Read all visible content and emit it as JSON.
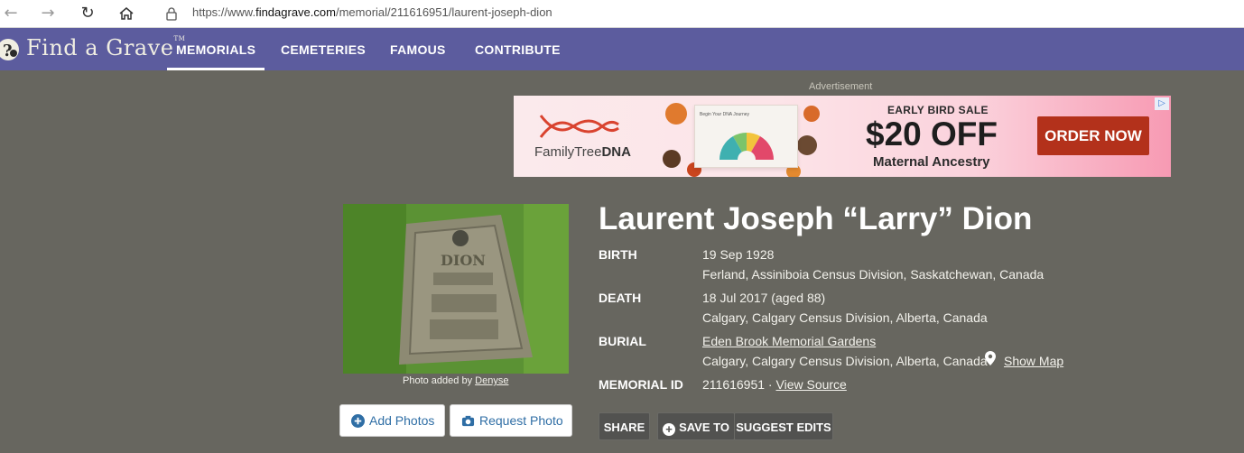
{
  "browser": {
    "url_prefix": "https://www.",
    "url_domain": "findagrave.com",
    "url_path": "/memorial/211616951/laurent-joseph-dion",
    "back_icon": "back-arrow-icon",
    "forward_icon": "forward-arrow-icon",
    "reload_icon": "reload-icon",
    "home_icon": "home-icon"
  },
  "header": {
    "logo": "Find a Grave",
    "logo_tm": "TM",
    "nav": [
      {
        "label": "MEMORIALS",
        "active": true
      },
      {
        "label": "CEMETERIES",
        "active": false
      },
      {
        "label": "FAMOUS",
        "active": false
      },
      {
        "label": "CONTRIBUTE",
        "active": false
      }
    ],
    "bg_color": "#5c5c9e"
  },
  "ad": {
    "label": "Advertisement",
    "brand_light": "FamilyTree",
    "brand_bold": "DNA",
    "product_title": "Begin Your DNA Journey",
    "headline": "EARLY BIRD SALE",
    "price": "$20 OFF",
    "subline": "Maternal Ancestry",
    "cta": "ORDER NOW",
    "cta_color": "#b3311b"
  },
  "photo": {
    "caption_prefix": "Photo added by",
    "caption_user": "Denyse",
    "add_photos": "Add Photos",
    "request_photo": "Request Photo"
  },
  "memorial": {
    "name": "Laurent Joseph “Larry” Dion",
    "birth_label": "BIRTH",
    "birth_date": "19 Sep 1928",
    "birth_place": "Ferland, Assiniboia Census Division, Saskatchewan, Canada",
    "death_label": "DEATH",
    "death_date": "18 Jul 2017 (aged 88)",
    "death_place": "Calgary, Calgary Census Division, Alberta, Canada",
    "burial_label": "BURIAL",
    "burial_cemetery": "Eden Brook Memorial Gardens",
    "burial_place": "Calgary, Calgary Census Division, Alberta, Canada",
    "show_map": "Show Map",
    "id_label": "MEMORIAL ID",
    "id_value": "211616951",
    "id_sep": " · ",
    "view_source": "View Source"
  },
  "actions": {
    "share": "SHARE",
    "save_to": "SAVE TO",
    "suggest_edits": "SUGGEST EDITS"
  }
}
